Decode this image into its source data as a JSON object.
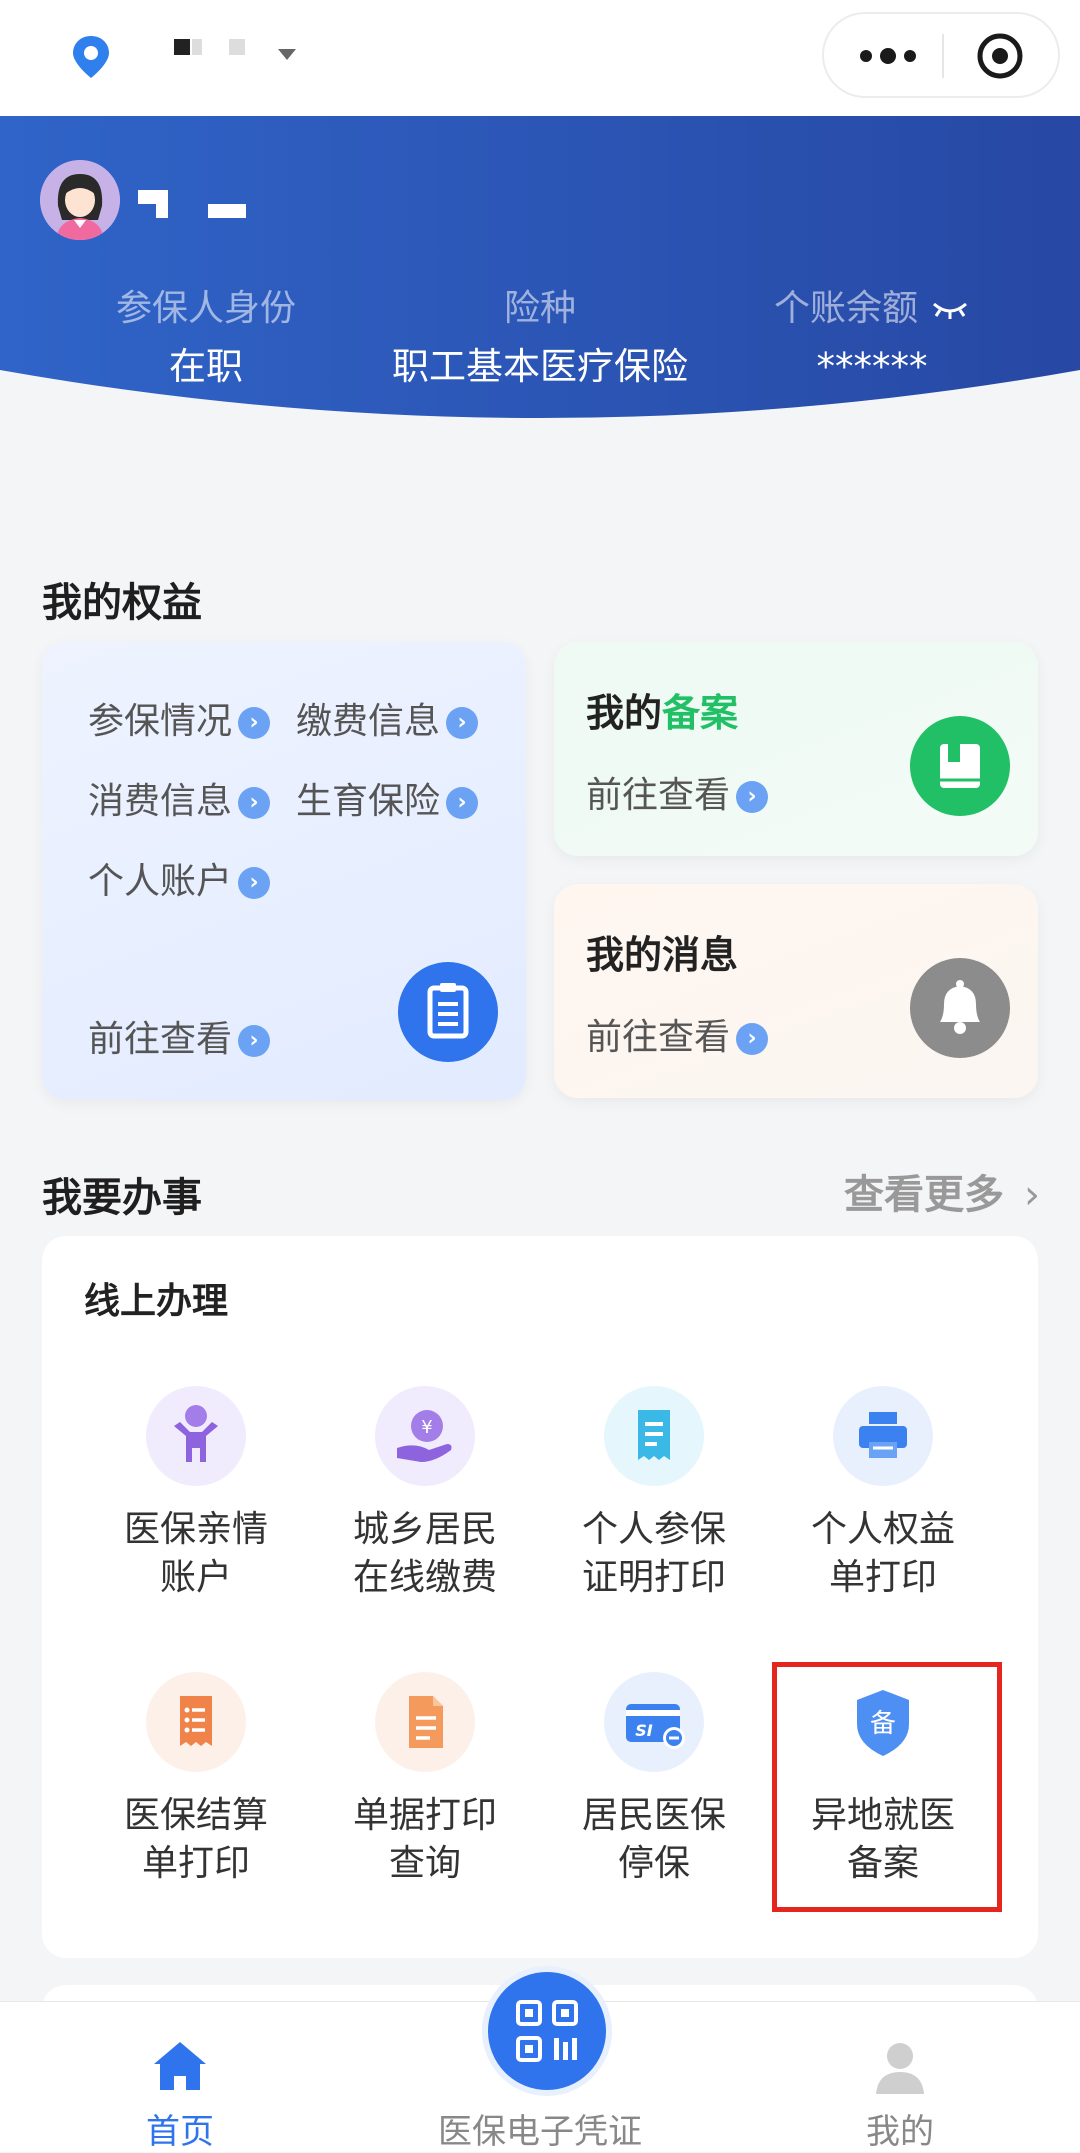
{
  "header": {
    "avatar_alt": "avatar",
    "identity_label": "参保人身份",
    "identity_value": "在职",
    "insurance_label": "险种",
    "insurance_value": "职工基本医疗保险",
    "balance_label": "个账余额",
    "balance_value": "******"
  },
  "rights": {
    "title": "我的权益",
    "links": [
      "参保情况",
      "缴费信息",
      "消费信息",
      "生育保险",
      "个人账户"
    ],
    "view_label": "前往查看",
    "filing_title_prefix": "我的",
    "filing_title_highlight": "备案",
    "filing_view": "前往查看",
    "message_title": "我的消息",
    "message_view": "前往查看"
  },
  "services": {
    "title": "我要办事",
    "more_label": "查看更多",
    "online_label": "线上办理",
    "items": [
      {
        "line1": "医保亲情",
        "line2": "账户",
        "icon": "family-icon"
      },
      {
        "line1": "城乡居民",
        "line2": "在线缴费",
        "icon": "payment-icon"
      },
      {
        "line1": "个人参保",
        "line2": "证明打印",
        "icon": "certificate-icon"
      },
      {
        "line1": "个人权益",
        "line2": "单打印",
        "icon": "printer-icon"
      },
      {
        "line1": "医保结算",
        "line2": "单打印",
        "icon": "receipt-icon"
      },
      {
        "line1": "单据打印",
        "line2": "查询",
        "icon": "document-icon"
      },
      {
        "line1": "居民医保",
        "line2": "停保",
        "icon": "card-stop-icon"
      },
      {
        "line1": "异地就医",
        "line2": "备案",
        "icon": "shield-icon",
        "shield_char": "备",
        "highlighted": true
      }
    ]
  },
  "tabbar": {
    "home": "首页",
    "voucher": "医保电子凭证",
    "me": "我的"
  },
  "colors": {
    "primary_blue": "#2f74ec",
    "header_blue": "#2a4fb0",
    "green": "#22c066",
    "highlight_red": "#e5261e"
  }
}
